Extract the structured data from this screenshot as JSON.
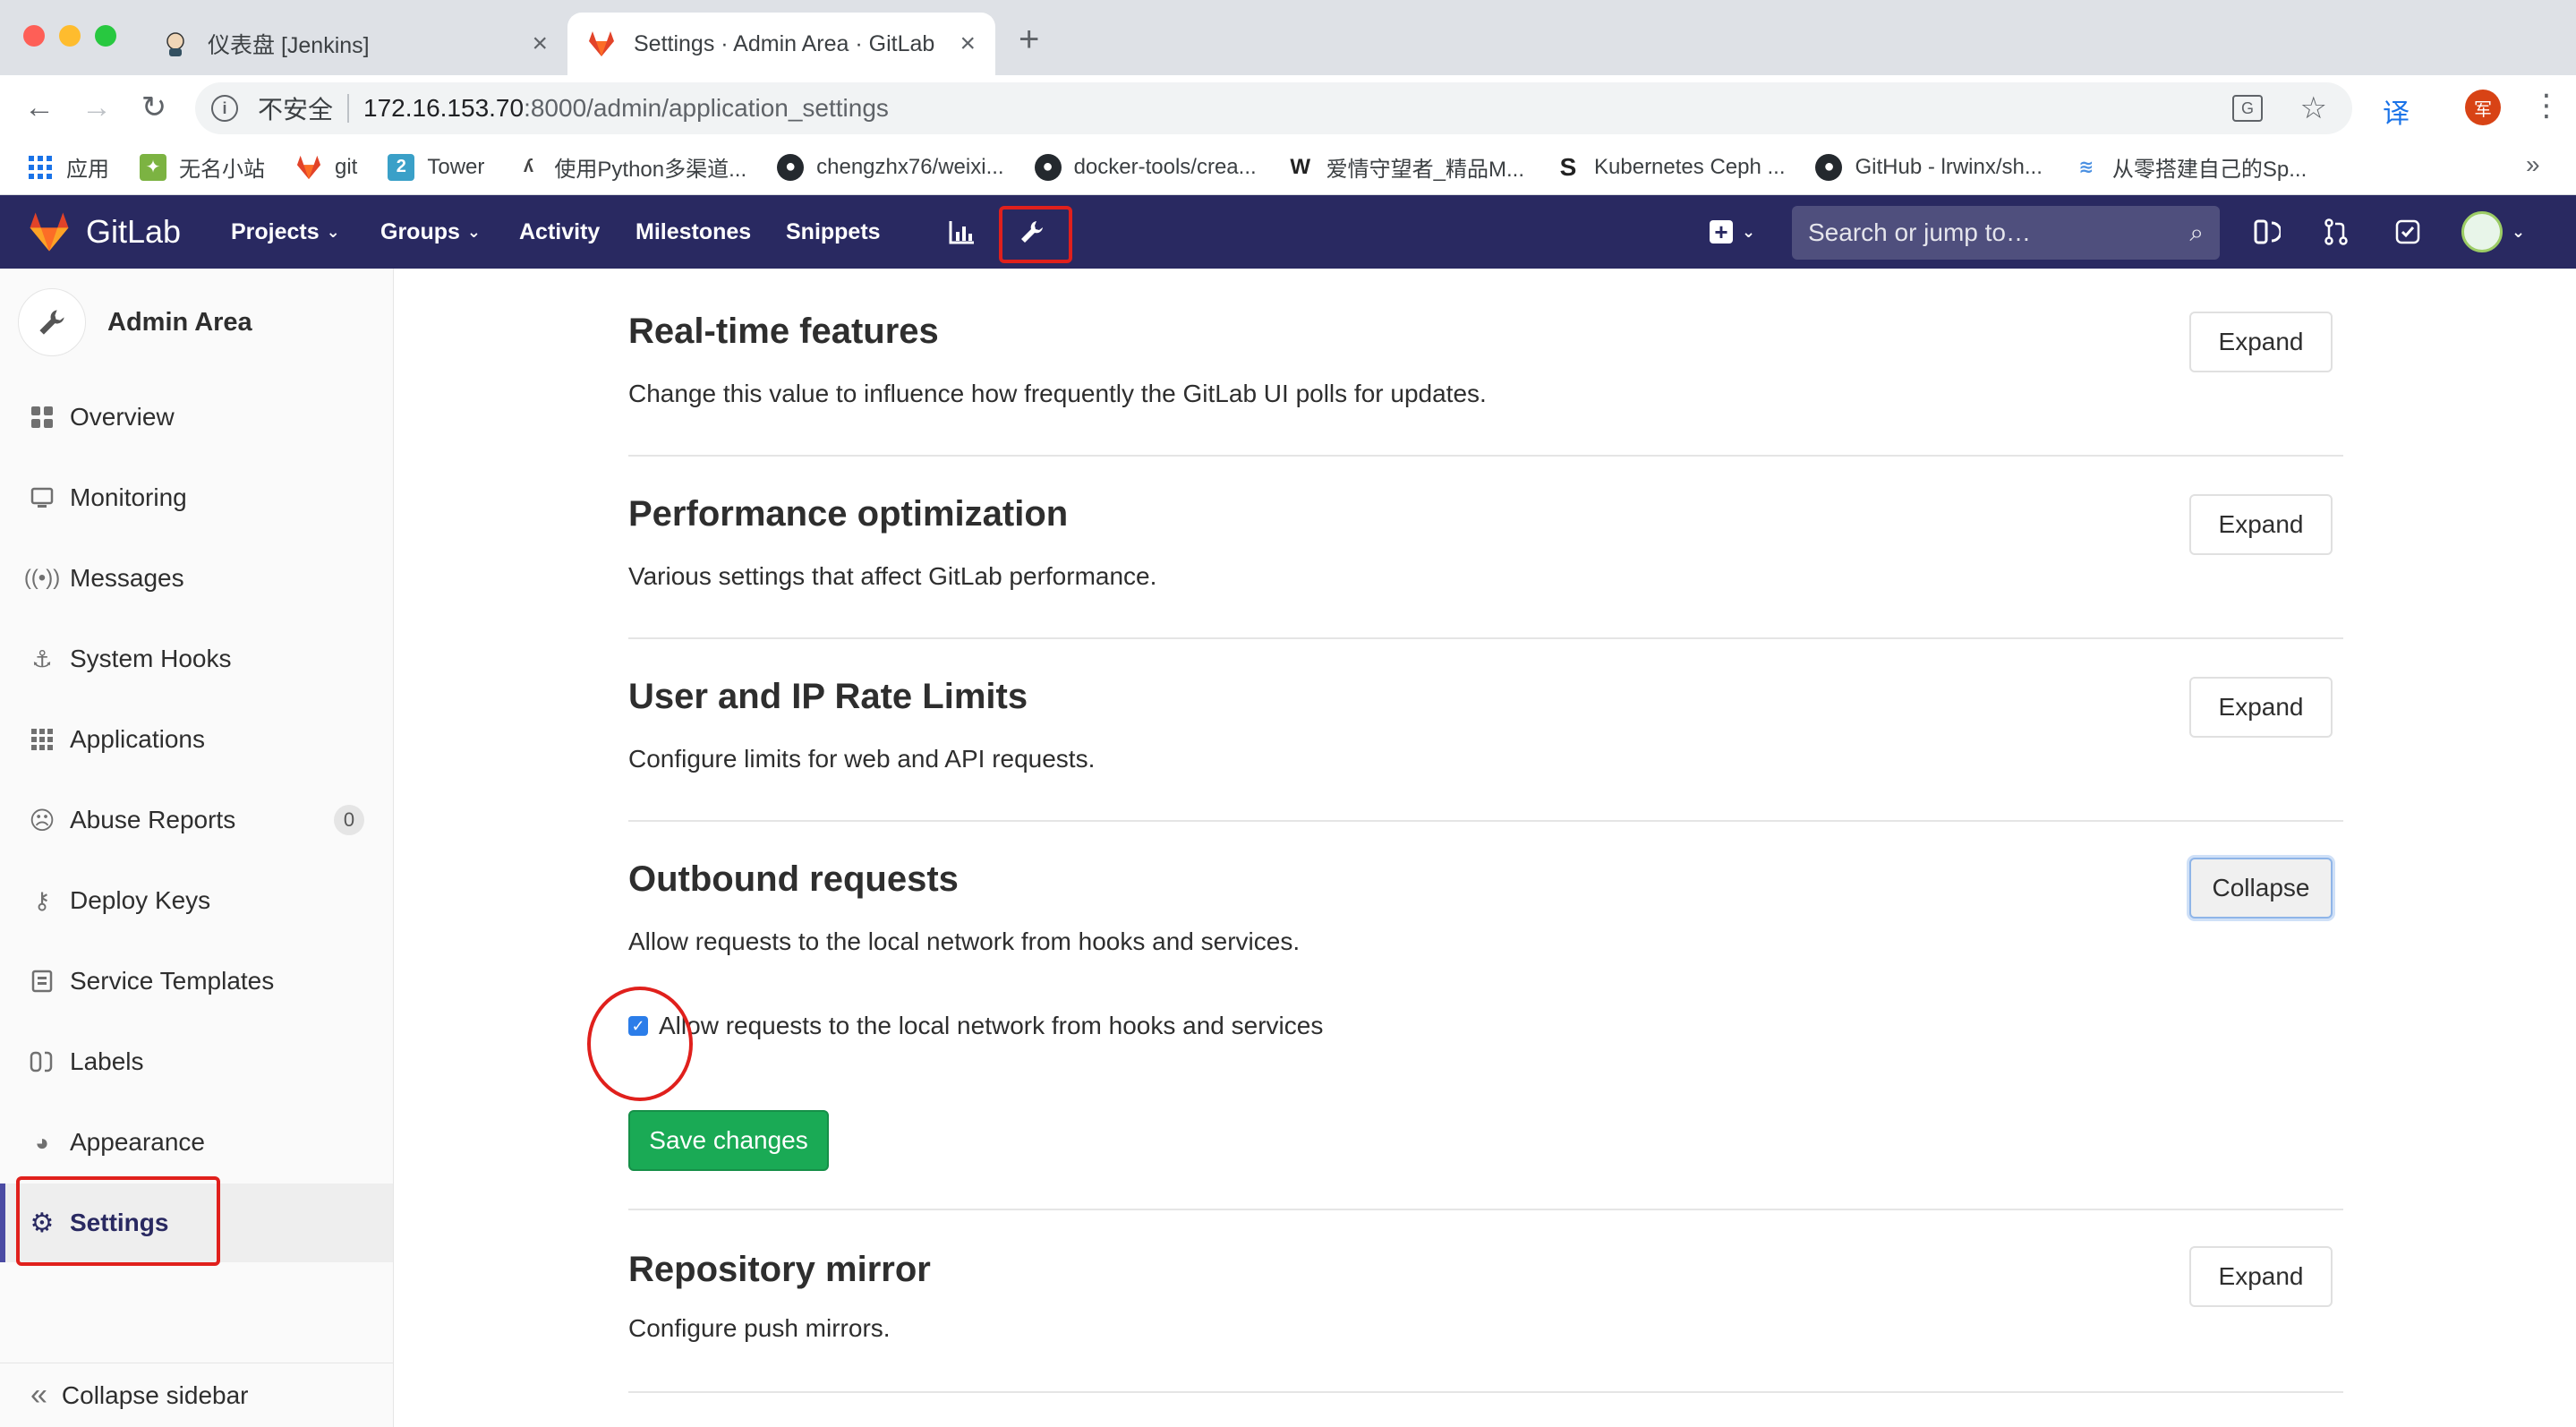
{
  "browser": {
    "tabs": [
      {
        "title": "仪表盘 [Jenkins]",
        "active": false
      },
      {
        "title": "Settings · Admin Area · GitLab",
        "active": true
      }
    ],
    "new_tab": "+",
    "address": {
      "security": "不安全",
      "host": "172.16.153.70",
      "rest": ":8000/admin/application_settings"
    },
    "ext_translate": "译",
    "profile_initial": "军",
    "bookmarks": [
      {
        "label": "应用",
        "icon": "apps-grid-icon",
        "color": "#1a73e8"
      },
      {
        "label": "无名小站",
        "icon": "site-icon",
        "color": "#7cb342"
      },
      {
        "label": "git",
        "icon": "gitlab-fox-icon",
        "color": "#e24329"
      },
      {
        "label": "Tower",
        "icon": "tower-icon",
        "color": "#3aa0c8"
      },
      {
        "label": "使用Python多渠道...",
        "icon": "python-icon",
        "color": "#444444"
      },
      {
        "label": "chengzhx76/weixi...",
        "icon": "github-icon",
        "color": "#24292e"
      },
      {
        "label": "docker-tools/crea...",
        "icon": "github-icon",
        "color": "#24292e"
      },
      {
        "label": "爱情守望者_精品M...",
        "icon": "w-icon",
        "color": "#222222"
      },
      {
        "label": "Kubernetes Ceph ...",
        "icon": "s-icon",
        "color": "#222222"
      },
      {
        "label": "GitHub - lrwinx/sh...",
        "icon": "github-icon",
        "color": "#24292e"
      },
      {
        "label": "从零搭建自己的Sp...",
        "icon": "layers-icon",
        "color": "#4a90e2"
      }
    ],
    "more": "»"
  },
  "header": {
    "logo": "GitLab",
    "nav": [
      "Projects",
      "Groups",
      "Activity",
      "Milestones",
      "Snippets"
    ],
    "search_placeholder": "Search or jump to…"
  },
  "sidebar": {
    "title": "Admin Area",
    "items": [
      {
        "label": "Overview",
        "icon": "overview-icon"
      },
      {
        "label": "Monitoring",
        "icon": "monitor-icon"
      },
      {
        "label": "Messages",
        "icon": "broadcast-icon"
      },
      {
        "label": "System Hooks",
        "icon": "hook-icon"
      },
      {
        "label": "Applications",
        "icon": "applications-icon"
      },
      {
        "label": "Abuse Reports",
        "icon": "abuse-icon",
        "badge": "0"
      },
      {
        "label": "Deploy Keys",
        "icon": "key-icon"
      },
      {
        "label": "Service Templates",
        "icon": "template-icon"
      },
      {
        "label": "Labels",
        "icon": "labels-icon"
      },
      {
        "label": "Appearance",
        "icon": "palette-icon"
      },
      {
        "label": "Settings",
        "icon": "gear-icon",
        "active": true
      }
    ],
    "collapse": "Collapse sidebar"
  },
  "sections": [
    {
      "title": "Real-time features",
      "desc": "Change this value to influence how frequently the GitLab UI polls for updates.",
      "button": "Expand"
    },
    {
      "title": "Performance optimization",
      "desc": "Various settings that affect GitLab performance.",
      "button": "Expand"
    },
    {
      "title": "User and IP Rate Limits",
      "desc": "Configure limits for web and API requests.",
      "button": "Expand"
    },
    {
      "title": "Outbound requests",
      "desc": "Allow requests to the local network from hooks and services.",
      "button": "Collapse"
    },
    {
      "title": "Repository mirror",
      "desc": "Configure push mirrors.",
      "button": "Expand"
    }
  ],
  "outbound": {
    "checkbox_label": "Allow requests to the local network from hooks and services",
    "checked": true,
    "save": "Save changes"
  },
  "colors": {
    "header": "#292961",
    "save": "#1aaa55",
    "annotation": "#e0201c",
    "accent": "#4b4ba3"
  }
}
